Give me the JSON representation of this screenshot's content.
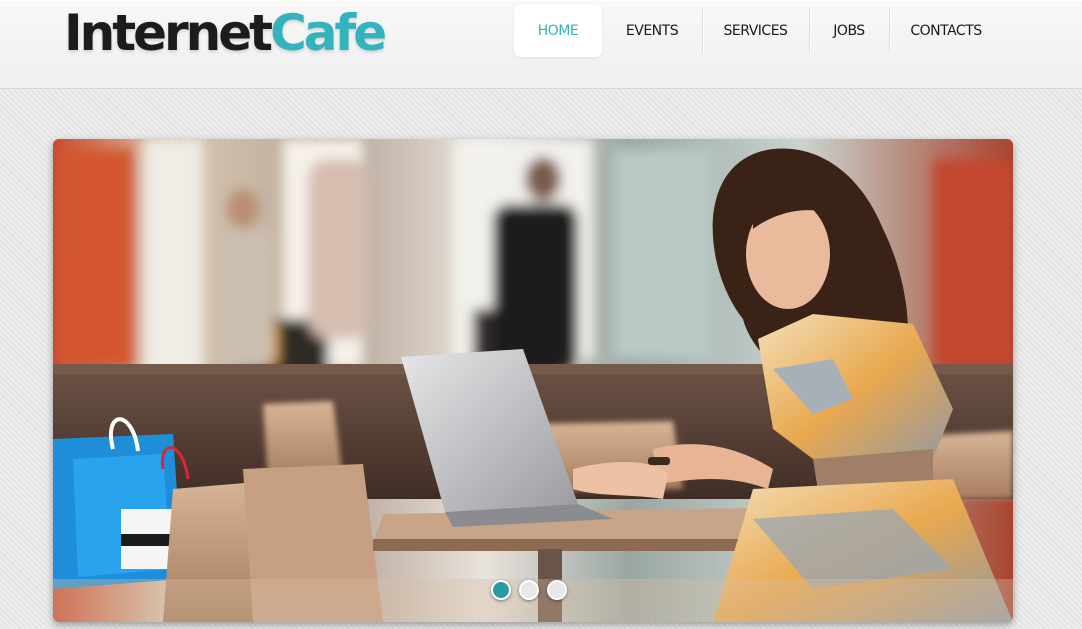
{
  "brand": {
    "part1": "Internet",
    "part2": "Cafe",
    "accent_color": "#32b3bd",
    "dark_color": "#1c1c1c"
  },
  "nav": {
    "items": [
      {
        "label": "HOME",
        "active": true
      },
      {
        "label": "EVENTS",
        "active": false
      },
      {
        "label": "SERVICES",
        "active": false
      },
      {
        "label": "JOBS",
        "active": false
      },
      {
        "label": "CONTACTS",
        "active": false
      }
    ]
  },
  "slider": {
    "slide_count": 3,
    "active_slide": 1,
    "active_dot_color": "#2b9aa3"
  }
}
